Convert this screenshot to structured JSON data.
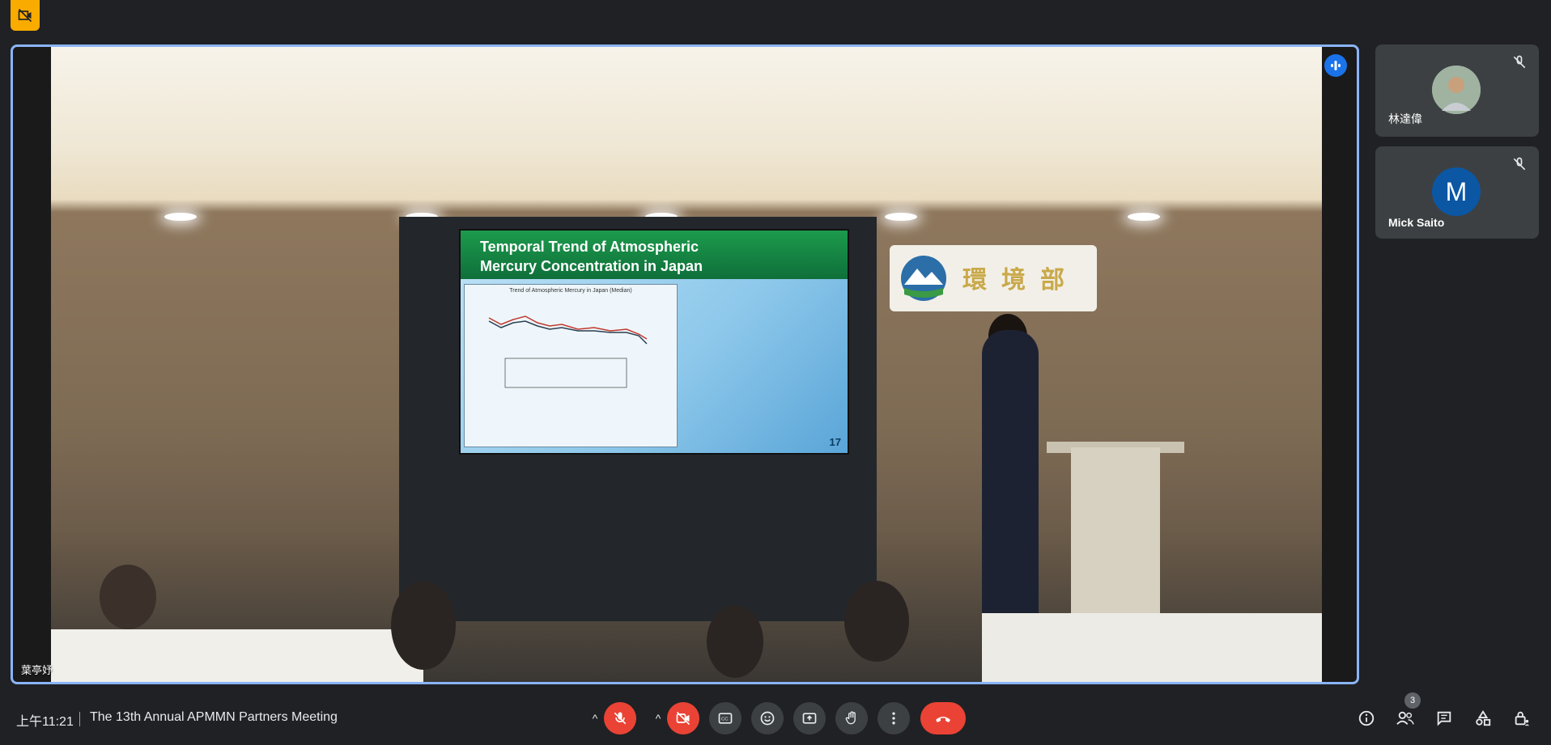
{
  "main_tile": {
    "participant_name": "葉亭妤",
    "slide": {
      "title_line1": "Temporal Trend of Atmospheric",
      "title_line2": "Mercury Concentration in Japan",
      "chart_caption": "Trend of Atmospheric Mercury in Japan (Median)",
      "page_number": "17"
    }
  },
  "side_tiles": [
    {
      "name": "林達偉",
      "avatar_letter": ""
    },
    {
      "name": "Mick Saito",
      "avatar_letter": "M"
    }
  ],
  "bottom_bar": {
    "time": "上午11:21",
    "meeting_title": "The 13th Annual APMMN Partners Meeting",
    "people_count": "3"
  },
  "colors": {
    "accent_blue": "#8ab4f8",
    "danger_red": "#ea4335",
    "badge_yellow": "#f9ab00",
    "avatar_blue": "#1a73e8"
  }
}
